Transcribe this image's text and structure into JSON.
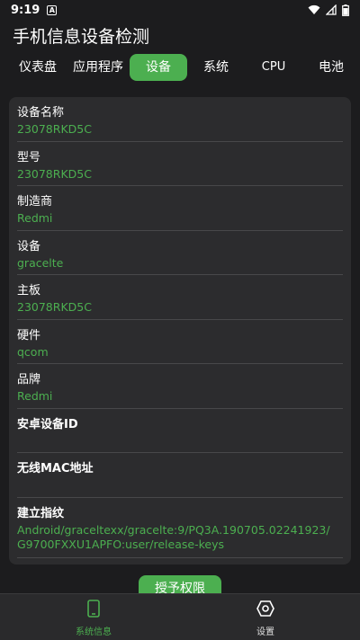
{
  "status": {
    "time": "9:19",
    "notif_icon_letter": "A"
  },
  "app": {
    "title": "手机信息设备检测"
  },
  "tabs": [
    {
      "label": "仪表盘"
    },
    {
      "label": "应用程序"
    },
    {
      "label": "设备"
    },
    {
      "label": "系统"
    },
    {
      "label": "CPU"
    },
    {
      "label": "电池"
    }
  ],
  "active_tab": "设备",
  "device_info": [
    {
      "label": "设备名称",
      "value": "23078RKD5C"
    },
    {
      "label": "型号",
      "value": "23078RKD5C"
    },
    {
      "label": "制造商",
      "value": "Redmi"
    },
    {
      "label": "设备",
      "value": "gracelte"
    },
    {
      "label": "主板",
      "value": "23078RKD5C"
    },
    {
      "label": "硬件",
      "value": "qcom"
    },
    {
      "label": "品牌",
      "value": "Redmi"
    },
    {
      "label": "安卓设备ID",
      "value": ""
    },
    {
      "label": "无线MAC地址",
      "value": ""
    },
    {
      "label": "建立指纹",
      "value_line1": "Android/graceltexx/gracelte:9/PQ3A.190705.02241923/",
      "value_line2": "G9700FXXU1APFO:user/release-keys"
    }
  ],
  "grant_button": {
    "label": "授予权限"
  },
  "bottom_nav": [
    {
      "label": "系统信息",
      "icon": "phone-icon"
    },
    {
      "label": "设置",
      "icon": "settings-icon"
    }
  ],
  "colors": {
    "accent": "#4caf50",
    "background": "#1c1c1e",
    "card": "#2c2c2e"
  }
}
